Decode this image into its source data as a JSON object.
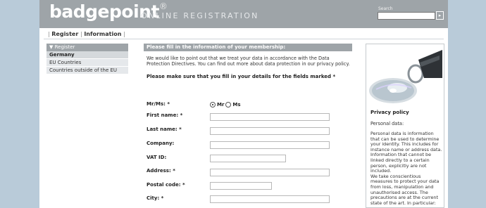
{
  "header": {
    "logo": "badgepoint",
    "registered": "®",
    "tagline": "ONLINE REGISTRATION",
    "search_label": "Search",
    "search_button": "▸"
  },
  "nav": {
    "items": [
      "Register",
      "Information"
    ]
  },
  "sidebar": {
    "heading": "▼ Register",
    "items": [
      "Germany",
      "EU Countries",
      "Countries outside of the EU"
    ]
  },
  "main": {
    "heading": "Please fill in the information of your membership:",
    "intro": "We would like to point out that we treat your data in accordance with the Data Protection Directives. You can find out more about data protection in our privacy policy.",
    "notice": "Please make sure that you fill in your details for the fields marked *",
    "salutation_label": "Mr/Ms: *",
    "salutation_options": [
      "Mr",
      "Ms"
    ],
    "salutation_selected": "Mr",
    "fields": {
      "first_name": "First name: *",
      "last_name": "Last name: *",
      "company": "Company:",
      "vat_id": "VAT ID:",
      "address": "Address: *",
      "postal_code": "Postal code: *",
      "city": "City: *"
    }
  },
  "privacy": {
    "title": "Privacy policy",
    "subtitle": "Personal data:",
    "body": "Personal data is information that can be used to determine your identity. This includes for instance name or address data. Information that cannot be linked directly to a certain person, explicitly are not included.",
    "body2": "We take conscientious measures to protect your data from loss, manipulation and unauthorised access. The precautions are at the current state of the art. In particular:"
  },
  "colors": {
    "background": "#b9cbd9",
    "header": "#9ea4a8",
    "panel": "#e5e8eb"
  }
}
